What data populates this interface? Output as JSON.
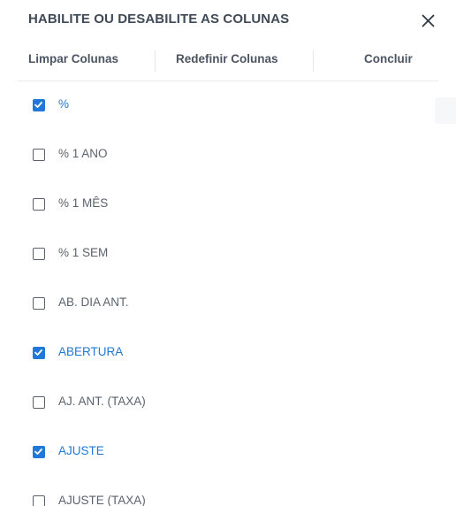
{
  "header": {
    "title": "HABILITE OU DESABILITE AS COLUNAS",
    "close_icon": "close-icon"
  },
  "toolbar": {
    "clear_label": "Limpar Colunas",
    "reset_label": "Redefinir Colunas",
    "done_label": "Concluir"
  },
  "columns": [
    {
      "label": "%",
      "checked": true
    },
    {
      "label": "% 1 ANO",
      "checked": false
    },
    {
      "label": "% 1 MÊS",
      "checked": false
    },
    {
      "label": "% 1 SEM",
      "checked": false
    },
    {
      "label": "AB. DIA ANT.",
      "checked": false
    },
    {
      "label": "ABERTURA",
      "checked": true
    },
    {
      "label": "AJ. ANT. (TAXA)",
      "checked": false
    },
    {
      "label": "AJUSTE",
      "checked": true
    },
    {
      "label": "AJUSTE (TAXA)",
      "checked": false
    }
  ],
  "colors": {
    "accent": "#2178d6",
    "text": "#3f4a56",
    "muted_text": "#5a636d",
    "divider": "#e7ebef"
  }
}
